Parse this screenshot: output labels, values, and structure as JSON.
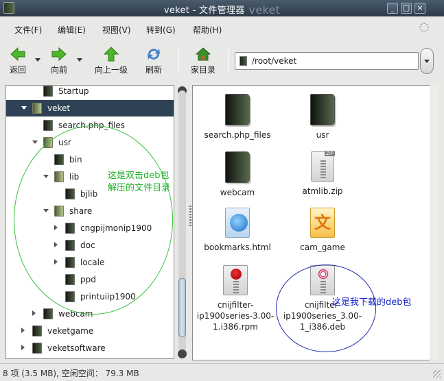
{
  "window": {
    "title": "veket - 文件管理器",
    "title_ghost": "veket",
    "buttons": [
      "_",
      "□",
      "×"
    ]
  },
  "menu": [
    "文件(F)",
    "编辑(E)",
    "视图(V)",
    "转到(G)",
    "帮助(H)"
  ],
  "toolbar": {
    "back": "返回",
    "forward": "向前",
    "up": "向上一级",
    "refresh": "刷新",
    "home": "家目录"
  },
  "location": {
    "path": "/root/veket"
  },
  "tree": [
    {
      "label": "Startup",
      "level": 2,
      "expander": "none",
      "selected": false
    },
    {
      "label": "veket",
      "level": 1,
      "expander": "open",
      "selected": true
    },
    {
      "label": "search.php_files",
      "level": 2,
      "expander": "none",
      "selected": false
    },
    {
      "label": "usr",
      "level": 2,
      "expander": "open",
      "selected": false
    },
    {
      "label": "bin",
      "level": 3,
      "expander": "none",
      "selected": false
    },
    {
      "label": "lib",
      "level": 3,
      "expander": "open",
      "selected": false
    },
    {
      "label": "bjlib",
      "level": 4,
      "expander": "none",
      "selected": false
    },
    {
      "label": "share",
      "level": 3,
      "expander": "open",
      "selected": false
    },
    {
      "label": "cngpijmonip1900",
      "level": 4,
      "expander": "closed",
      "selected": false
    },
    {
      "label": "doc",
      "level": 4,
      "expander": "closed",
      "selected": false
    },
    {
      "label": "locale",
      "level": 4,
      "expander": "closed",
      "selected": false
    },
    {
      "label": "ppd",
      "level": 4,
      "expander": "none",
      "selected": false
    },
    {
      "label": "printuiip1900",
      "level": 4,
      "expander": "none",
      "selected": false
    },
    {
      "label": "webcam",
      "level": 2,
      "expander": "closed",
      "selected": false
    },
    {
      "label": "veketgame",
      "level": 1,
      "expander": "closed",
      "selected": false
    },
    {
      "label": "veketsoftware",
      "level": 1,
      "expander": "closed",
      "selected": false
    }
  ],
  "files": [
    {
      "name": "search.php_files",
      "type": "folder-icon"
    },
    {
      "name": "usr",
      "type": "folder-icon"
    },
    {
      "name": "webcam",
      "type": "folder-icon"
    },
    {
      "name": "atmlib.zip",
      "type": "zip-icon",
      "badge": "ZIP"
    },
    {
      "name": "bookmarks.html",
      "type": "html-icon"
    },
    {
      "name": "cam_game",
      "type": "game-icon",
      "glyph": "文"
    },
    {
      "name": "cnijfilter-ip1900series-3.00-1.i386.rpm",
      "lines": [
        "cnijfilter-",
        "ip1900series-3.00-",
        "1.i386.rpm"
      ],
      "type": "rpm-package-icon"
    },
    {
      "name": "cnijfilter-ip1900series_3.00-1_i386.deb",
      "lines": [
        "cnijfilter-",
        "ip1900series_3.00-",
        "1_i386.deb"
      ],
      "type": "deb-package-icon"
    }
  ],
  "annotations": {
    "green_note": [
      "这是双击deb包",
      "解压的文件目录"
    ],
    "blue_note": "这是我下载的deb包",
    "green_color": "#22b02a",
    "blue_color": "#1b25c9"
  },
  "status": "8 项 (3.5 MB), 空闲空间： 79.3 MB"
}
